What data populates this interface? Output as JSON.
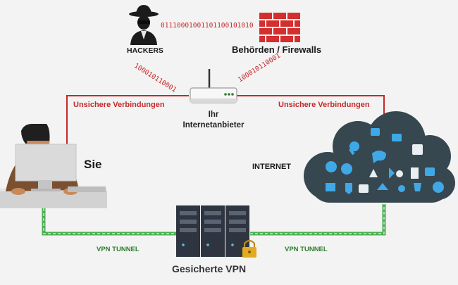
{
  "labels": {
    "hackers": "HACKERS",
    "authorities": "Behörden / Firewalls",
    "binary_top": "01110001001101100101010",
    "binary_left": "100010110001",
    "binary_right": "100010110001",
    "unsafe_left": "Unsichere Verbindungen",
    "unsafe_right": "Unsichere Verbindungen",
    "isp_line1": "Ihr",
    "isp_line2": "Internetanbieter",
    "you": "Sie",
    "internet": "INTERNET",
    "vpn_tunnel_left": "VPN TUNNEL",
    "vpn_tunnel_right": "VPN TUNNEL",
    "secured_vpn": "Gesicherte VPN"
  },
  "colors": {
    "unsafe_line": "#c62828",
    "tunnel": "#4caf50",
    "cloud": "#37474f",
    "server": "#2f3540",
    "firewall": "#d32f2f"
  },
  "icons": [
    "hacker-icon",
    "firewall-icon",
    "router-icon",
    "user-at-computer-icon",
    "internet-cloud-icon",
    "vpn-server-icon",
    "padlock-icon"
  ]
}
